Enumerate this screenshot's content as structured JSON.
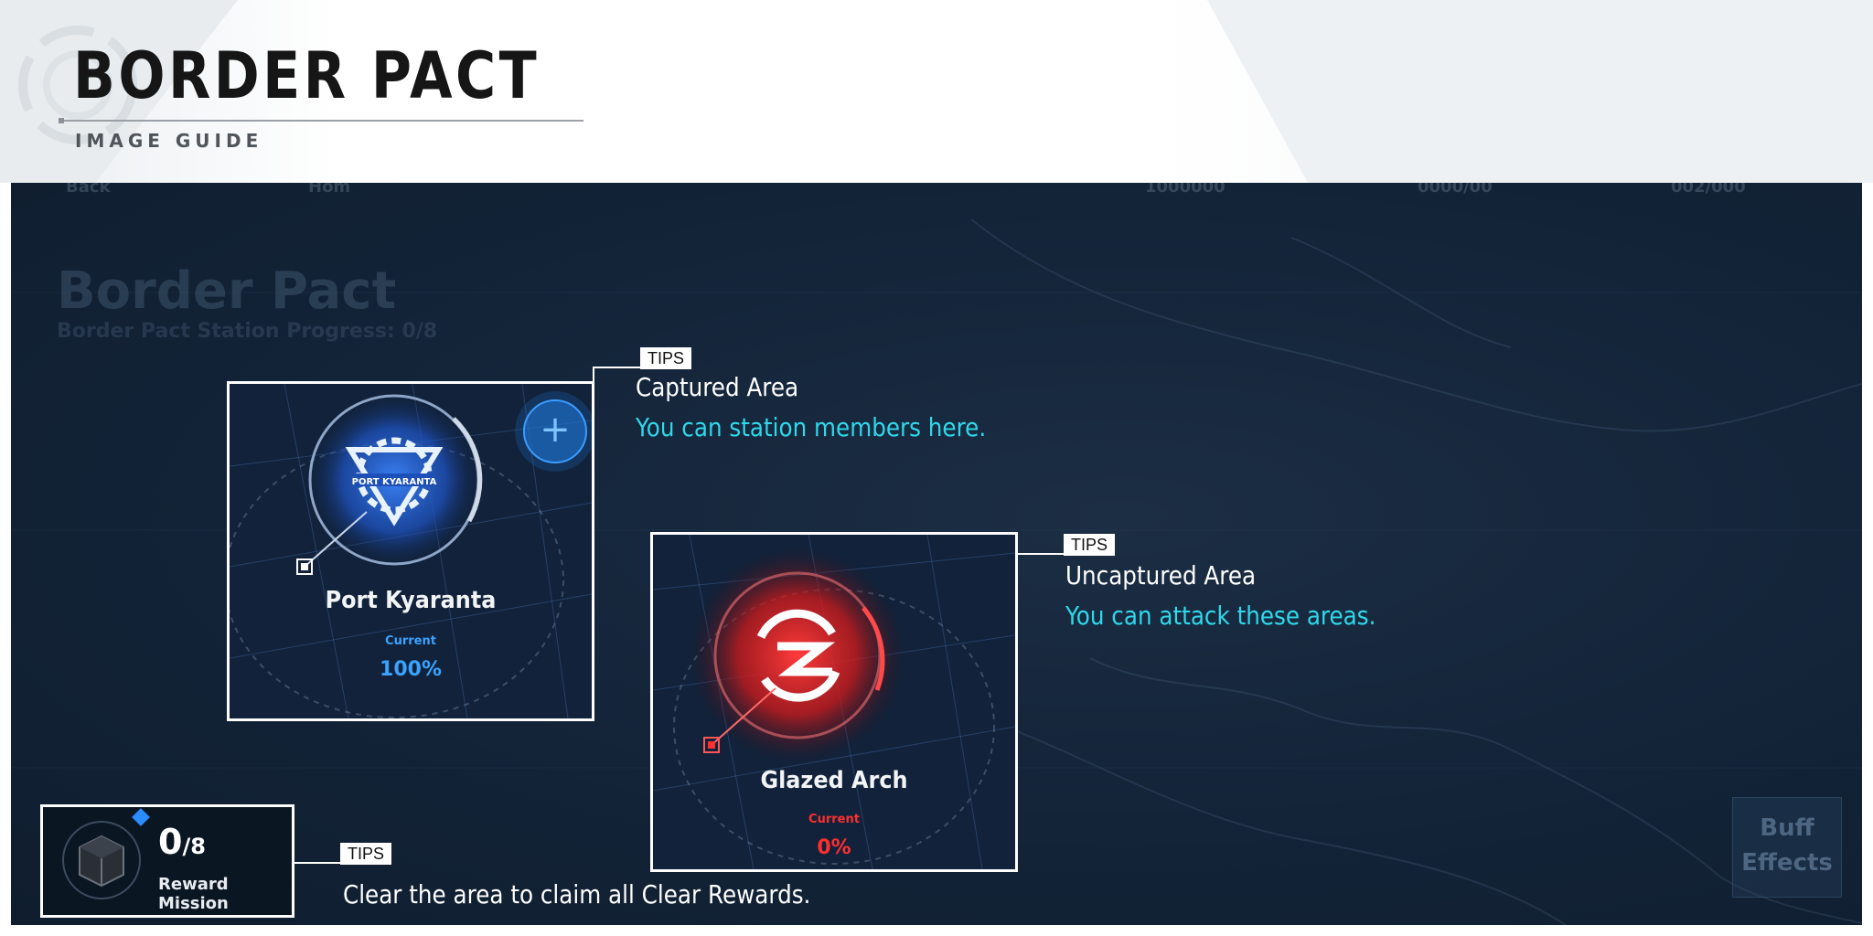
{
  "header": {
    "title": "BORDER PACT",
    "subtitle": "IMAGE GUIDE"
  },
  "screen": {
    "faded_top": {
      "back": "Back",
      "home": "Hom",
      "res1": "1000000",
      "res2": "0000/00",
      "res3": "002/000"
    },
    "faded_title": "Border Pact",
    "faded_progress": "Border Pact Station Progress: 0/8",
    "buff_button": "Buff Effects"
  },
  "captured_card": {
    "emblem_text": "PORT KYARANTA",
    "name": "Port Kyaranta",
    "current_label": "Current",
    "percent": "100%",
    "accent": "#2a8cff"
  },
  "uncaptured_card": {
    "name": "Glazed Arch",
    "current_label": "Current",
    "percent": "0%",
    "accent": "#ff2a2a"
  },
  "tips": {
    "tag": "TIPS",
    "captured": {
      "head": "Captured Area",
      "body": "You can station members here."
    },
    "uncaptured": {
      "head": "Uncaptured Area",
      "body": "You can attack these areas."
    },
    "reward": {
      "body": "Clear the area to claim all Clear Rewards."
    }
  },
  "reward_mission": {
    "count": "0",
    "total": "/8",
    "label": "Reward Mission"
  },
  "colors": {
    "tip_highlight": "#2fd8ea",
    "screen_bg": "#14253a"
  }
}
